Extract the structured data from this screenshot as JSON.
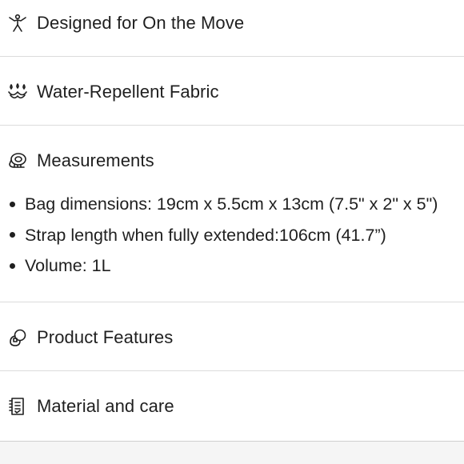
{
  "accordion": [
    {
      "icon": "person-moving-icon",
      "label": "Designed for On the Move"
    },
    {
      "icon": "water-drops-icon",
      "label": "Water-Repellent Fabric"
    },
    {
      "icon": "tape-measure-icon",
      "label": "Measurements"
    },
    {
      "icon": "product-features-icon",
      "label": "Product Features"
    },
    {
      "icon": "care-label-icon",
      "label": "Material and care"
    }
  ],
  "measurements": {
    "bullets": [
      "Bag dimensions: 19cm x 5.5cm x 13cm (7.5\" x 2\" x 5\")",
      "Strap length when fully extended:106cm (41.7”)",
      "Volume: 1L"
    ]
  },
  "colors": {
    "text": "#1f1f1f",
    "divider": "#dcdcdc",
    "background": "#ffffff"
  }
}
